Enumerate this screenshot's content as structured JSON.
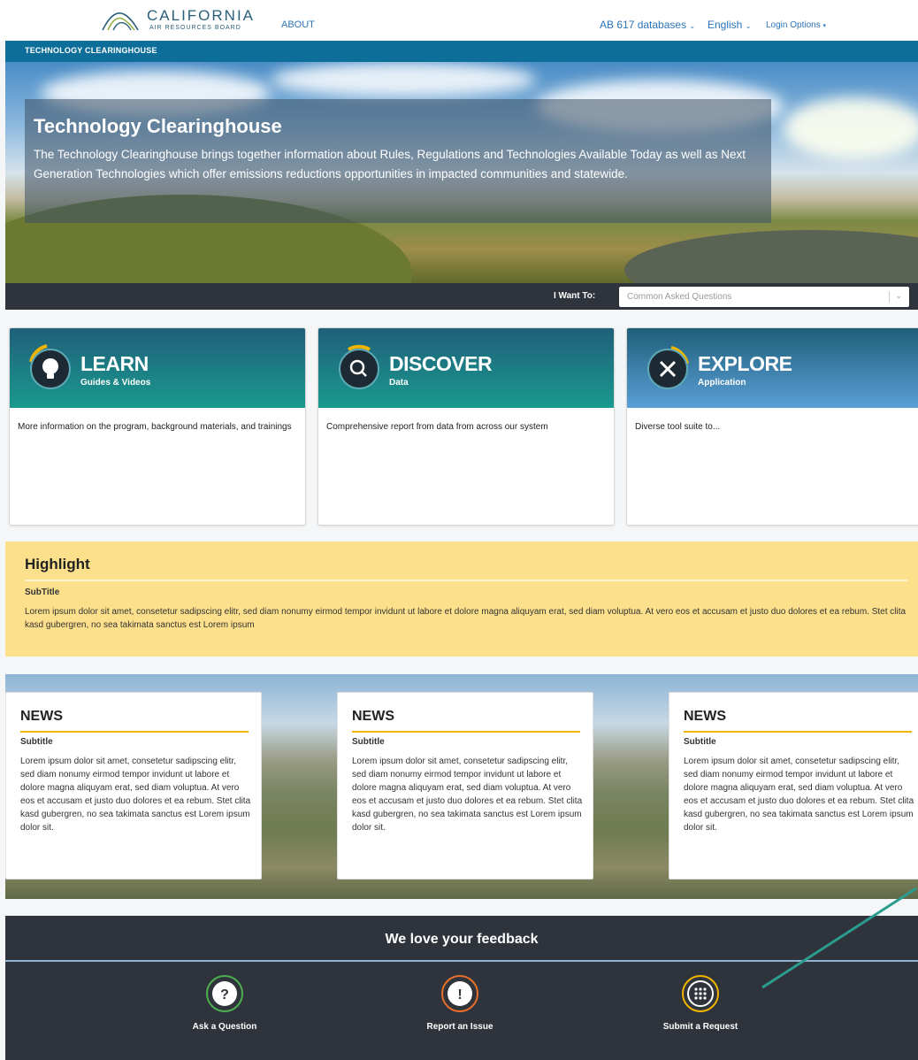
{
  "header": {
    "logo_title": "CALIFORNIA",
    "logo_subtitle": "AIR RESOURCES BOARD",
    "about": "ABOUT",
    "databases": "AB 617 databases",
    "language": "English",
    "login": "Login Options"
  },
  "band": {
    "label": "TECHNOLOGY CLEARINGHOUSE"
  },
  "hero": {
    "title": "Technology Clearinghouse",
    "text": "The Technology Clearinghouse brings together information about Rules, Regulations and Technologies Available Today as well as Next Generation Technologies which offer emissions reductions opportunities in impacted communities and statewide."
  },
  "want": {
    "label": "I Want To:",
    "placeholder": "Common Asked Questions"
  },
  "cards": [
    {
      "title": "LEARN",
      "subtitle": "Guides & Videos",
      "body": "More information on the program, background materials, and trainings",
      "icon": "lightbulb-icon"
    },
    {
      "title": "DISCOVER",
      "subtitle": "Data",
      "body": "Comprehensive report from data from across our system",
      "icon": "search-icon"
    },
    {
      "title": "EXPLORE",
      "subtitle": "Application",
      "body": "Diverse tool suite to...",
      "icon": "tools-icon"
    }
  ],
  "highlight": {
    "title": "Highlight",
    "subtitle": "SubTitle",
    "text": "Lorem ipsum dolor sit amet, consetetur sadipscing elitr, sed diam nonumy eirmod tempor invidunt ut labore et dolore magna aliquyam erat, sed diam voluptua. At vero eos et accusam et justo duo dolores et ea rebum. Stet clita kasd gubergren, no sea takimata sanctus est Lorem ipsum"
  },
  "news": [
    {
      "title": "NEWS",
      "subtitle": "Subtitle",
      "text": "Lorem ipsum dolor sit amet, consetetur sadipscing elitr, sed diam nonumy eirmod tempor invidunt ut labore et dolore magna aliquyam erat, sed diam voluptua. At vero eos et accusam et justo duo dolores et ea rebum. Stet clita kasd gubergren, no sea takimata sanctus est Lorem ipsum dolor sit."
    },
    {
      "title": "NEWS",
      "subtitle": "Subtitle",
      "text": "Lorem ipsum dolor sit amet, consetetur sadipscing elitr, sed diam nonumy eirmod tempor invidunt ut labore et dolore magna aliquyam erat, sed diam voluptua. At vero eos et accusam et justo duo dolores et ea rebum. Stet clita kasd gubergren, no sea takimata sanctus est Lorem ipsum dolor sit."
    },
    {
      "title": "NEWS",
      "subtitle": "Subtitle",
      "text": "Lorem ipsum dolor sit amet, consetetur sadipscing elitr, sed diam nonumy eirmod tempor invidunt ut labore et dolore magna aliquyam erat, sed diam voluptua. At vero eos et accusam et justo duo dolores et ea rebum. Stet clita kasd gubergren, no sea takimata sanctus est Lorem ipsum dolor sit."
    }
  ],
  "feedback": {
    "title": "We love your feedback",
    "items": [
      {
        "label": "Ask a Question",
        "icon": "question-icon",
        "color": "#4caf50"
      },
      {
        "label": "Report an Issue",
        "icon": "exclamation-icon",
        "color": "#e8702a"
      },
      {
        "label": "Submit a Request",
        "icon": "grid-dots-icon",
        "color": "#f0b400"
      }
    ]
  },
  "colors": {
    "band": "#0e6e9a",
    "teal": "#1a9a8e",
    "highlight": "#fde08c",
    "dark": "#2f343c",
    "accent": "#f0b400",
    "arrow": "#2a9d8f"
  }
}
